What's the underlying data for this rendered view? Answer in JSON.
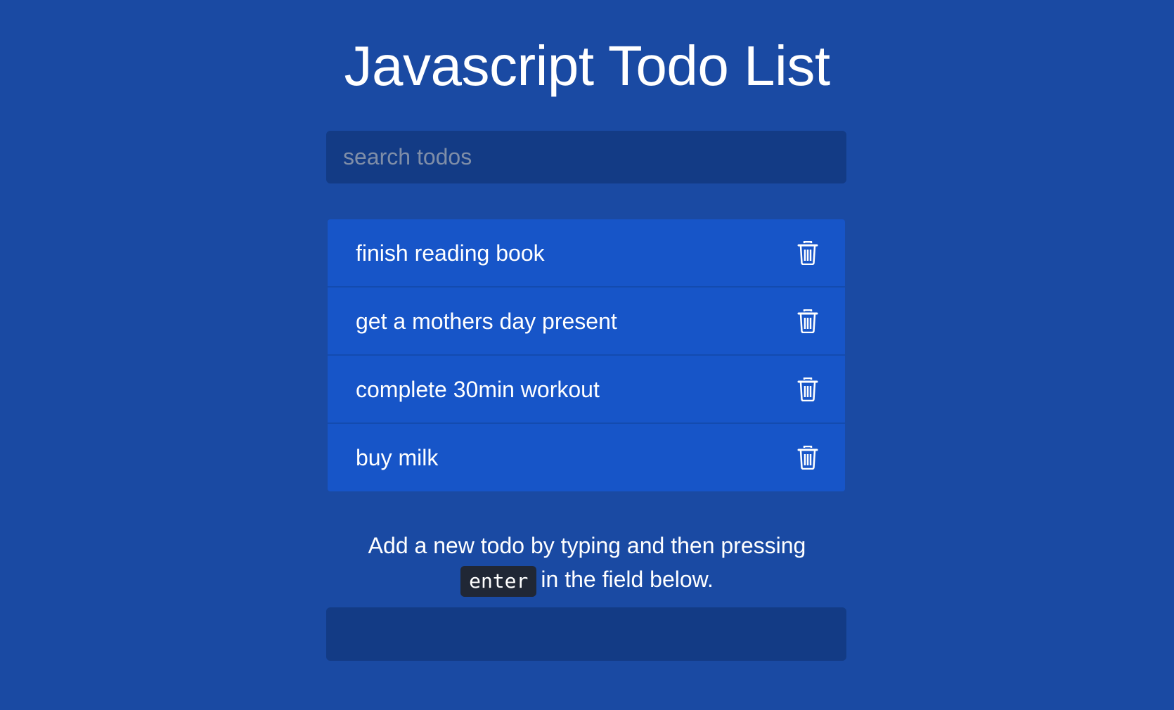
{
  "page": {
    "title": "Javascript Todo List"
  },
  "search": {
    "placeholder": "search todos",
    "value": ""
  },
  "todos": [
    {
      "text": "finish reading book",
      "icon": "trash-icon"
    },
    {
      "text": "get a mothers day present",
      "icon": "trash-icon"
    },
    {
      "text": "complete 30min workout",
      "icon": "trash-icon"
    },
    {
      "text": "buy milk",
      "icon": "trash-icon"
    }
  ],
  "instructions": {
    "line1": "Add a new todo by typing and then pressing",
    "key": "enter",
    "line2": "in the field below."
  },
  "add_todo": {
    "value": "",
    "placeholder": ""
  },
  "colors": {
    "background": "#1a4aa3",
    "input_background": "#133b85",
    "list_item": "#1755c8",
    "key_badge": "#202735",
    "text": "#ffffff"
  }
}
